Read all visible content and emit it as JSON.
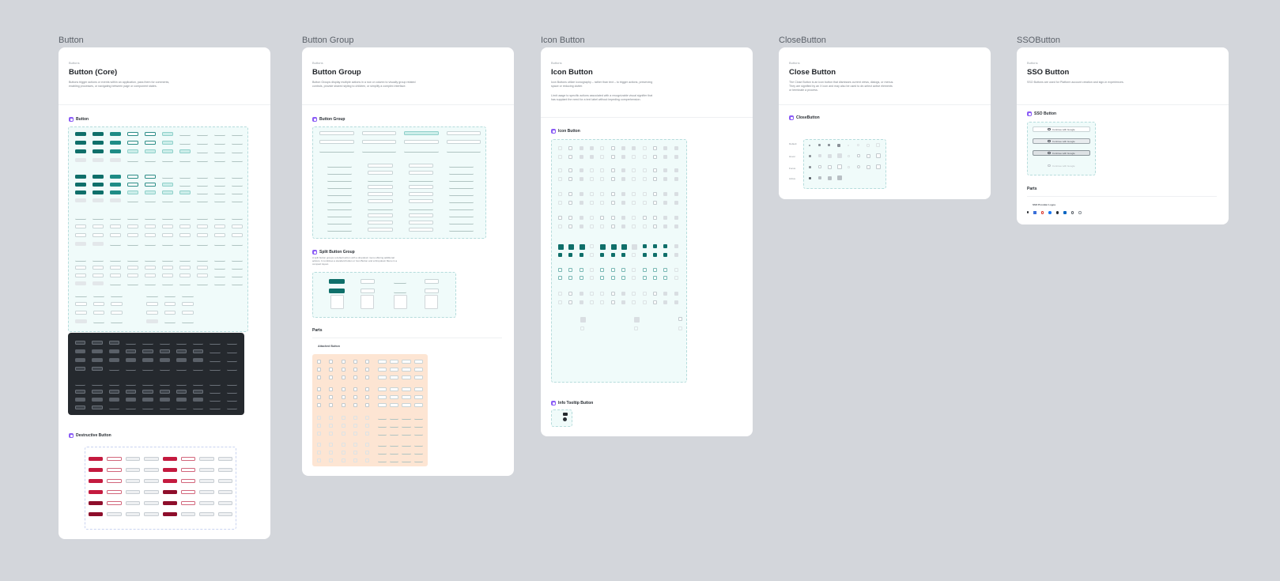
{
  "frames": {
    "button": {
      "label": "Button",
      "eyebrow": "Buttons",
      "title": "Button (Core)",
      "description": "Buttons trigger actions or events within an application, pass them for comments, enabling processes, or navigating between page or component states.",
      "section_button": "Button",
      "section_destructive": "Destructive Button"
    },
    "button_group": {
      "label": "Button Group",
      "eyebrow": "Buttons",
      "title": "Button Group",
      "description": "Button Groups display multiple actions in a row or column to visually group related controls, provide shared styling to children, or simplify a complex interface.",
      "section_group": "Button Group",
      "section_split": "Split Button Group",
      "split_desc": "A split button groups a default action with a dropdown menu offering additional actions. It combines a standard button or Icon Button and a Dropdown Menu in a compact layout.",
      "parts": "Parts",
      "attached": "Attached Button"
    },
    "icon_button": {
      "label": "Icon Button",
      "eyebrow": "Buttons",
      "title": "Icon Button",
      "description": "Icon Buttons utilize iconography – rather than text – to trigger actions, preserving space or reducing clutter.",
      "description2": "Limit usage to specific actions associated with a recognizable visual signifier that has supplant the need for a text label without impeding comprehension.",
      "section_icon": "Icon Button",
      "section_tooltip": "Info Tooltip Button"
    },
    "close_button": {
      "label": "CloseButton",
      "eyebrow": "Buttons",
      "title": "Close Button",
      "description": "The Close Button is an icon button that dismisses current views, dialogs, or menus. They are signified by an X icon and may also be used to de-select active elements or terminate a process.",
      "section": "CloseButton",
      "rows": [
        "Default",
        "Hover",
        "Focus",
        "Active"
      ]
    },
    "sso_button": {
      "label": "SSOButton",
      "eyebrow": "Buttons",
      "title": "SSO Button",
      "description": "SSO Buttons are used for Platform account creation and sign-in experiences.",
      "section": "SSO Button",
      "btn_label": "Continue with Google",
      "parts": "Parts",
      "logos": "SSO Provider Logos"
    }
  },
  "colors": {
    "canvas": "#d3d6db",
    "accent_teal": "#0f6f6a",
    "destructive": "#c41a3f",
    "section_icon": "#8b5cf6",
    "attached_bg": "#fde5d3"
  }
}
